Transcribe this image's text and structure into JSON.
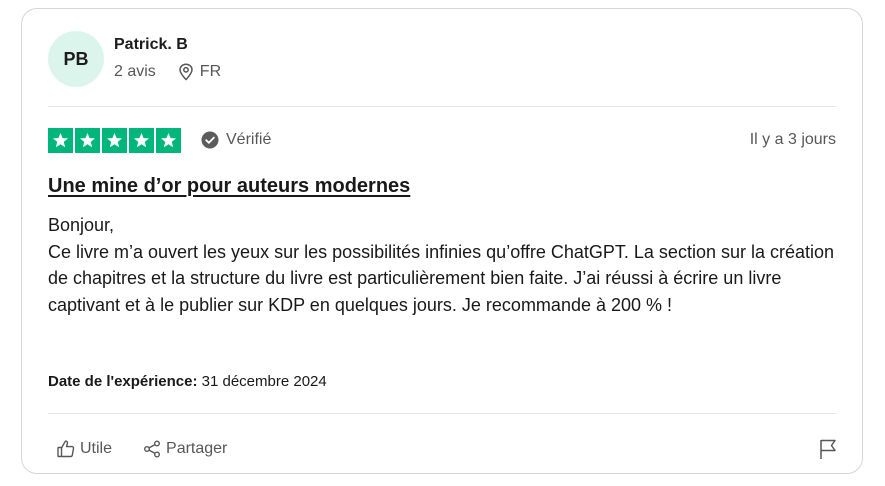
{
  "reviewer": {
    "initials": "PB",
    "name": "Patrick. B",
    "reviews_count": "2 avis",
    "country": "FR",
    "avatar_bg": "#dcf5ec"
  },
  "rating": {
    "stars": 5,
    "max_stars": 5,
    "star_color": "#00b67a",
    "verified_label": "Vérifié",
    "posted_ago": "Il y a 3 jours"
  },
  "review": {
    "title": "Une mine d’or pour auteurs modernes",
    "paragraphs": [
      "Bonjour,",
      "Ce livre m’a ouvert les yeux sur les possibilités infinies qu’offre ChatGPT. La section sur la création de chapitres et la structure du livre est particulièrement bien faite. J’ai réussi à écrire un livre captivant et à le publier sur KDP en quelques jours. Je recommande à 200 % !"
    ],
    "experience_label": "Date de l'expérience:",
    "experience_date": "31 décembre 2024"
  },
  "footer": {
    "useful_label": "Utile",
    "share_label": "Partager",
    "icons": [
      "thumbs-up-icon",
      "share-icon",
      "flag-icon"
    ]
  }
}
